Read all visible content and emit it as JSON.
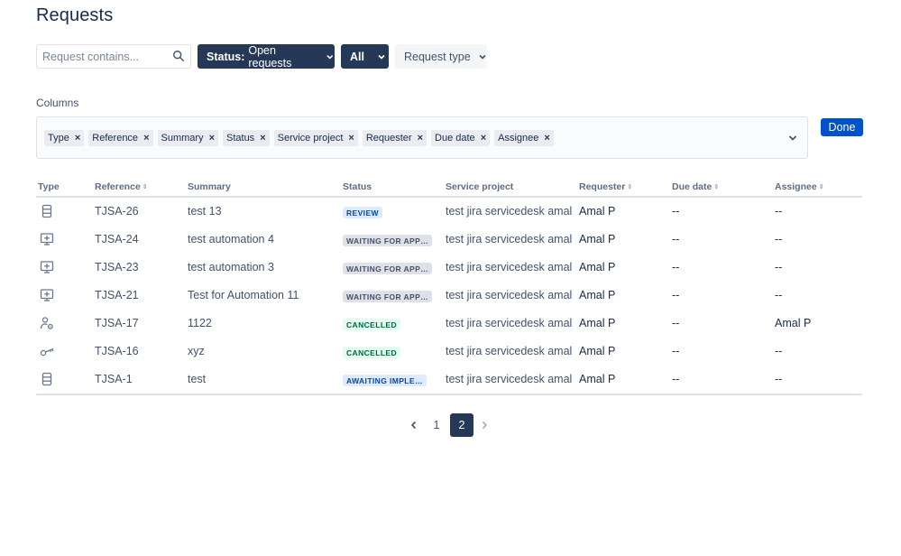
{
  "page": {
    "title": "Requests"
  },
  "filters": {
    "search_placeholder": "Request contains...",
    "search_icon": "search-icon",
    "status_prefix": "Status:",
    "status_value": "Open requests",
    "all_label": "All",
    "request_type_label": "Request type"
  },
  "columns": {
    "label": "Columns",
    "chips": [
      "Type",
      "Reference",
      "Summary",
      "Status",
      "Service project",
      "Requester",
      "Due date",
      "Assignee"
    ],
    "remove_glyph": "×",
    "done_label": "Done"
  },
  "table": {
    "headers": [
      "Type",
      "Reference",
      "Summary",
      "Status",
      "Service project",
      "Requester",
      "Due date",
      "Assignee"
    ],
    "rows": [
      {
        "type_icon": "server-icon",
        "reference": "TJSA-26",
        "summary": "test 13",
        "status": "REVIEW",
        "status_kind": "review",
        "project": "test jira servicedesk amal",
        "requester": "Amal P",
        "due_date": "--",
        "assignee": "--"
      },
      {
        "type_icon": "monitor-add-icon",
        "reference": "TJSA-24",
        "summary": "test automation 4",
        "status": "WAITING FOR APP…",
        "status_kind": "waiting",
        "project": "test jira servicedesk amal",
        "requester": "Amal P",
        "due_date": "--",
        "assignee": "--"
      },
      {
        "type_icon": "monitor-add-icon",
        "reference": "TJSA-23",
        "summary": "test automation 3",
        "status": "WAITING FOR APP…",
        "status_kind": "waiting",
        "project": "test jira servicedesk amal",
        "requester": "Amal P",
        "due_date": "--",
        "assignee": "--"
      },
      {
        "type_icon": "monitor-add-icon",
        "reference": "TJSA-21",
        "summary": "Test for Automation 11",
        "status": "WAITING FOR APP…",
        "status_kind": "waiting",
        "project": "test jira servicedesk amal",
        "requester": "Amal P",
        "due_date": "--",
        "assignee": "--"
      },
      {
        "type_icon": "user-settings-icon",
        "reference": "TJSA-17",
        "summary": "1122",
        "status": "CANCELLED",
        "status_kind": "cancelled",
        "project": "test jira servicedesk amal",
        "requester": "Amal P",
        "due_date": "--",
        "assignee": "Amal P"
      },
      {
        "type_icon": "key-icon",
        "reference": "TJSA-16",
        "summary": "xyz",
        "status": "CANCELLED",
        "status_kind": "cancelled",
        "project": "test jira servicedesk amal",
        "requester": "Amal P",
        "due_date": "--",
        "assignee": "--"
      },
      {
        "type_icon": "server-icon",
        "reference": "TJSA-1",
        "summary": "test",
        "status": "AWAITING IMPLE…",
        "status_kind": "awaiting",
        "project": "test jira servicedesk amal",
        "requester": "Amal P",
        "due_date": "--",
        "assignee": "--"
      }
    ]
  },
  "pagination": {
    "pages": [
      "1",
      "2"
    ],
    "current": "2"
  }
}
